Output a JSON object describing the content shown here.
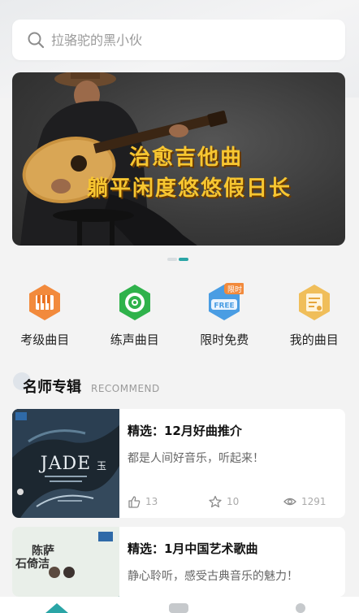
{
  "search": {
    "placeholder": "拉骆驼的黑小伙"
  },
  "banner": {
    "line1": "治愈吉他曲",
    "line2": "躺平闲度悠悠假日长"
  },
  "quick_links": [
    {
      "label": "考级曲目",
      "icon": "piano-icon",
      "color": "#f28a3c"
    },
    {
      "label": "练声曲目",
      "icon": "vinyl-icon",
      "color": "#2fb24b"
    },
    {
      "label": "限时免费",
      "icon": "free-tag-icon",
      "color": "#4a9de3",
      "badge": "限时",
      "tag": "FREE"
    },
    {
      "label": "我的曲目",
      "icon": "music-doc-icon",
      "color": "#f0be5a"
    }
  ],
  "section": {
    "title": "名师专辑",
    "subtitle": "RECOMMEND"
  },
  "albums": [
    {
      "title": "精选：12月好曲推介",
      "desc": "都是人间好音乐，听起来！",
      "likes": "13",
      "favorites": "10",
      "views": "1291",
      "cover": {
        "title": "JADE",
        "glyph": "玉"
      }
    },
    {
      "title": "精选：1月中国艺术歌曲",
      "desc": "静心聆听，感受古典音乐的魅力！",
      "cover": {
        "name1": "陈萨",
        "name2": "石倚洁"
      }
    }
  ],
  "colors": {
    "accent": "#2aa5a6",
    "banner_text": "#f7c631"
  }
}
